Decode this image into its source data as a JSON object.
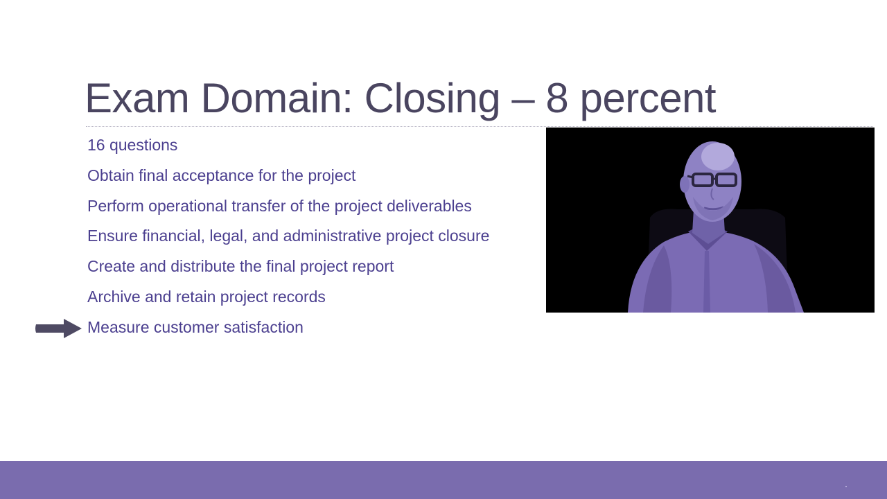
{
  "slide": {
    "title": "Exam Domain: Closing – 8 percent",
    "bullets": [
      "16 questions",
      "Obtain final acceptance for the project",
      "Perform operational transfer of the project deliverables",
      "Ensure financial, legal, and administrative project closure",
      "Create and distribute the final project report",
      "Archive and retain project records",
      "Measure customer satisfaction"
    ],
    "highlighted_bullet_index": 6
  },
  "theme": {
    "title_color": "#4a4560",
    "bullet_color": "#4b3f8f",
    "accent_color": "#7a6cae",
    "arrow_color": "#4e4a63",
    "video_background": "#000000"
  },
  "icons": {
    "pointer": "right-arrow-icon"
  }
}
